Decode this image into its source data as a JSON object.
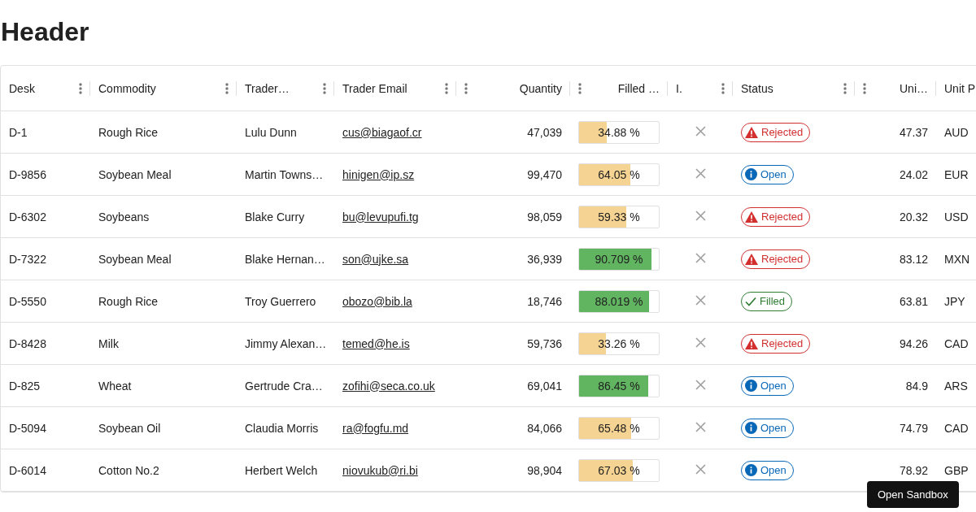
{
  "title": "Header",
  "columns": [
    {
      "label": "Desk",
      "numeric": false,
      "has_menu": true
    },
    {
      "label": "Commodity",
      "numeric": false,
      "has_menu": true
    },
    {
      "label": "Trader…",
      "numeric": false,
      "has_menu": true
    },
    {
      "label": "Trader Email",
      "numeric": false,
      "has_menu": true
    },
    {
      "label": "Quantity",
      "numeric": true,
      "has_menu": true
    },
    {
      "label": "Filled …",
      "numeric": true,
      "has_menu": true
    },
    {
      "label": "I.",
      "numeric": false,
      "has_menu": true
    },
    {
      "label": "Status",
      "numeric": false,
      "has_menu": true
    },
    {
      "label": "Uni…",
      "numeric": true,
      "has_menu": true
    },
    {
      "label": "Unit P",
      "numeric": false
    }
  ],
  "rows": [
    {
      "desk": "D-1",
      "commodity": "Rough Rice",
      "trader": "Lulu Dunn",
      "email": "cus@biagaof.cr",
      "quantity": "47,039",
      "filled": {
        "level": 0.3488,
        "reading": "34.88 %"
      },
      "is_filled": false,
      "status": {
        "kind": "rejected",
        "label": "Rejected"
      },
      "unit_price": "47.37",
      "currency": "AUD"
    },
    {
      "desk": "D-9856",
      "commodity": "Soybean Meal",
      "trader": "Martin Towns…",
      "email": "hinigen@ip.sz",
      "quantity": "99,470",
      "filled": {
        "level": 0.6405,
        "reading": "64.05 %"
      },
      "is_filled": false,
      "status": {
        "kind": "open",
        "label": "Open"
      },
      "unit_price": "24.02",
      "currency": "EUR"
    },
    {
      "desk": "D-6302",
      "commodity": "Soybeans",
      "trader": "Blake Curry",
      "email": "bu@levupufi.tg",
      "quantity": "98,059",
      "filled": {
        "level": 0.5933,
        "reading": "59.33 %"
      },
      "is_filled": false,
      "status": {
        "kind": "rejected",
        "label": "Rejected"
      },
      "unit_price": "20.32",
      "currency": "USD"
    },
    {
      "desk": "D-7322",
      "commodity": "Soybean Meal",
      "trader": "Blake Hernan…",
      "email": "son@ujke.sa",
      "quantity": "36,939",
      "filled": {
        "level": 0.90709,
        "reading": "90.709 %"
      },
      "is_filled": false,
      "status": {
        "kind": "rejected",
        "label": "Rejected"
      },
      "unit_price": "83.12",
      "currency": "MXN"
    },
    {
      "desk": "D-5550",
      "commodity": "Rough Rice",
      "trader": "Troy Guerrero",
      "email": "obozo@bib.la",
      "quantity": "18,746",
      "filled": {
        "level": 0.88019,
        "reading": "88.019 %"
      },
      "is_filled": false,
      "status": {
        "kind": "filled",
        "label": "Filled"
      },
      "unit_price": "63.81",
      "currency": "JPY"
    },
    {
      "desk": "D-8428",
      "commodity": "Milk",
      "trader": "Jimmy Alexan…",
      "email": "temed@he.is",
      "quantity": "59,736",
      "filled": {
        "level": 0.3326,
        "reading": "33.26 %"
      },
      "is_filled": false,
      "status": {
        "kind": "rejected",
        "label": "Rejected"
      },
      "unit_price": "94.26",
      "currency": "CAD"
    },
    {
      "desk": "D-825",
      "commodity": "Wheat",
      "trader": "Gertrude Cra…",
      "email": "zofihi@seca.co.uk",
      "quantity": "69,041",
      "filled": {
        "level": 0.8645,
        "reading": "86.45 %"
      },
      "is_filled": false,
      "status": {
        "kind": "open",
        "label": "Open"
      },
      "unit_price": "84.9",
      "currency": "ARS"
    },
    {
      "desk": "D-5094",
      "commodity": "Soybean Oil",
      "trader": "Claudia Morris",
      "email": "ra@fogfu.md",
      "quantity": "84,066",
      "filled": {
        "level": 0.6548,
        "reading": "65.48 %"
      },
      "is_filled": false,
      "status": {
        "kind": "open",
        "label": "Open"
      },
      "unit_price": "74.79",
      "currency": "CAD"
    },
    {
      "desk": "D-6014",
      "commodity": "Cotton No.2",
      "trader": "Herbert Welch",
      "email": "niovukub@ri.bi",
      "quantity": "98,904",
      "filled": {
        "level": 0.6703,
        "reading": "67.03 %"
      },
      "is_filled": false,
      "status": {
        "kind": "open",
        "label": "Open"
      },
      "unit_price": "78.92",
      "currency": "GBP"
    }
  ],
  "tooltip": "Open Sandbox"
}
